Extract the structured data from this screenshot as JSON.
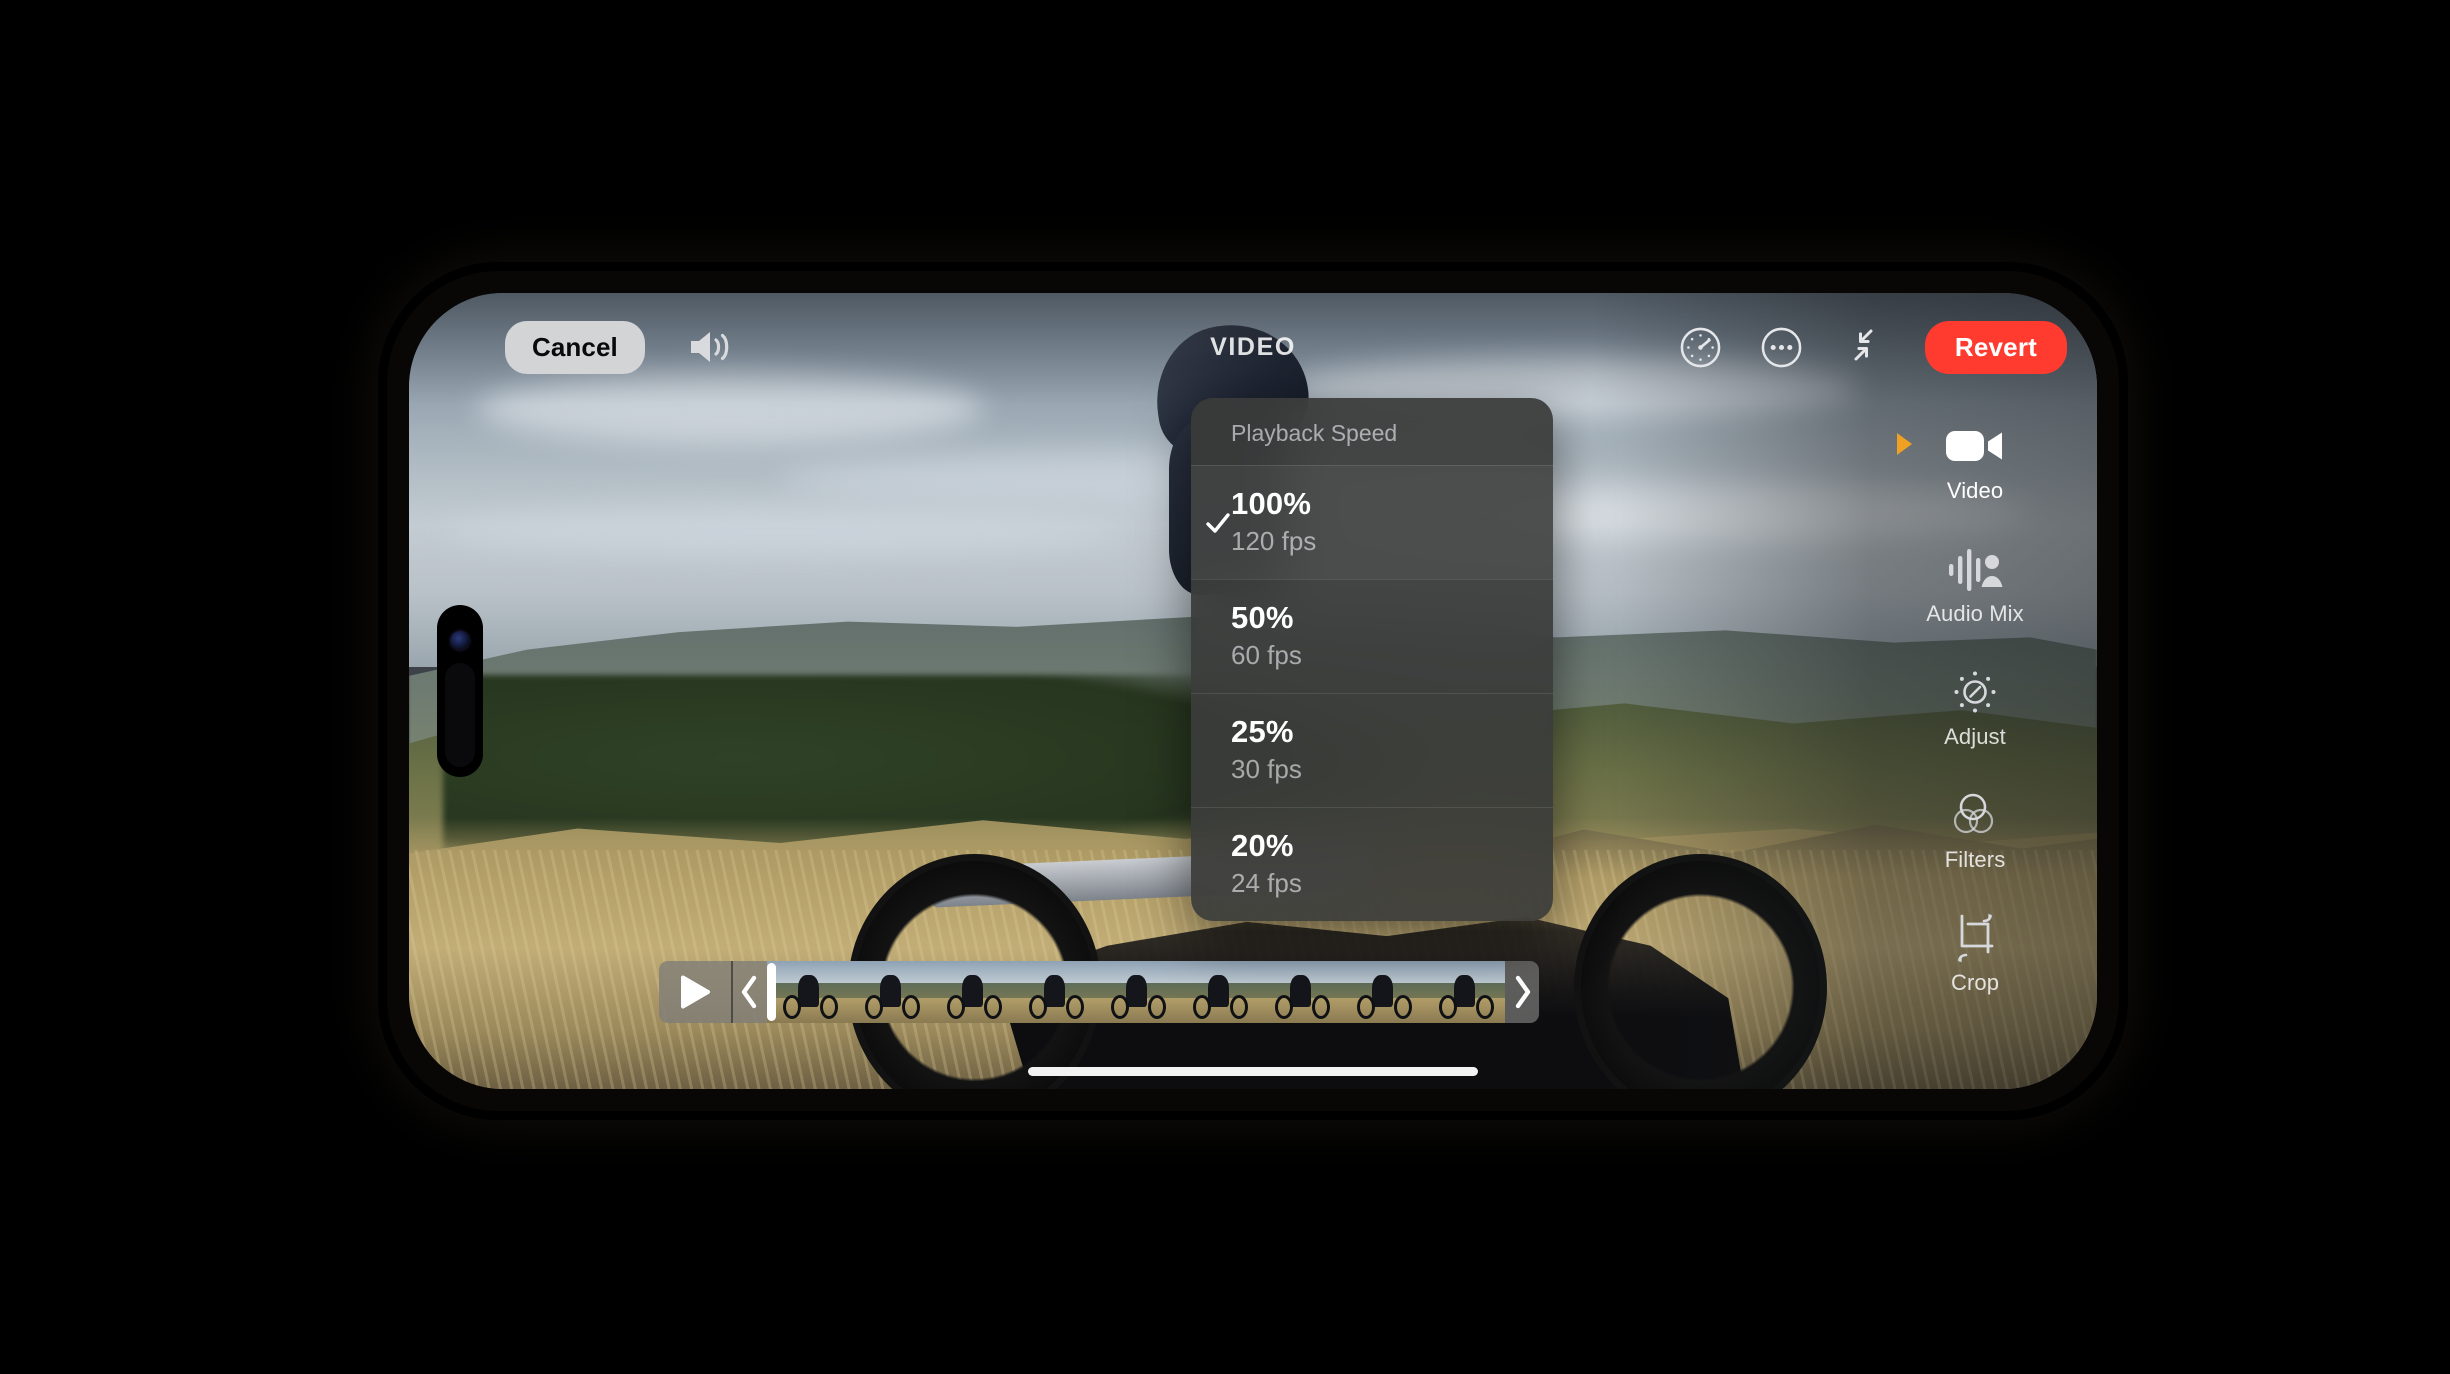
{
  "app": {
    "screen_title": "VIDEO"
  },
  "topbar": {
    "cancel_label": "Cancel",
    "revert_label": "Revert",
    "speaker_icon": "speaker-wave-icon",
    "speed_icon": "speedometer-icon",
    "more_icon": "ellipsis-circle-icon",
    "collapse_icon": "arrows-collapse-icon",
    "revert_color": "#ff3b30"
  },
  "speed_menu": {
    "title": "Playback Speed",
    "selected_index": 0,
    "check_icon": "checkmark-icon",
    "options": [
      {
        "percent": "100%",
        "fps": "120 fps",
        "selected": true
      },
      {
        "percent": "50%",
        "fps": "60 fps",
        "selected": false
      },
      {
        "percent": "25%",
        "fps": "30 fps",
        "selected": false
      },
      {
        "percent": "20%",
        "fps": "24 fps",
        "selected": false
      }
    ]
  },
  "tool_rail": {
    "active_marker_color": "#f0a023",
    "items": [
      {
        "label": "Video",
        "icon": "video-camera-icon",
        "active": true
      },
      {
        "label": "Audio Mix",
        "icon": "audio-mix-icon",
        "active": false
      },
      {
        "label": "Adjust",
        "icon": "adjust-brightness-icon",
        "active": false
      },
      {
        "label": "Filters",
        "icon": "filters-circles-icon",
        "active": false
      },
      {
        "label": "Crop",
        "icon": "crop-rotate-icon",
        "active": false
      }
    ]
  },
  "scrubber": {
    "play_icon": "play-triangle-icon",
    "trim_left_icon": "chevron-left-icon",
    "trim_right_icon": "chevron-right-icon",
    "playhead_position_percent": 0,
    "frame_count": 9
  },
  "device": {
    "home_indicator": "home-indicator",
    "dynamic_island": "dynamic-island"
  }
}
